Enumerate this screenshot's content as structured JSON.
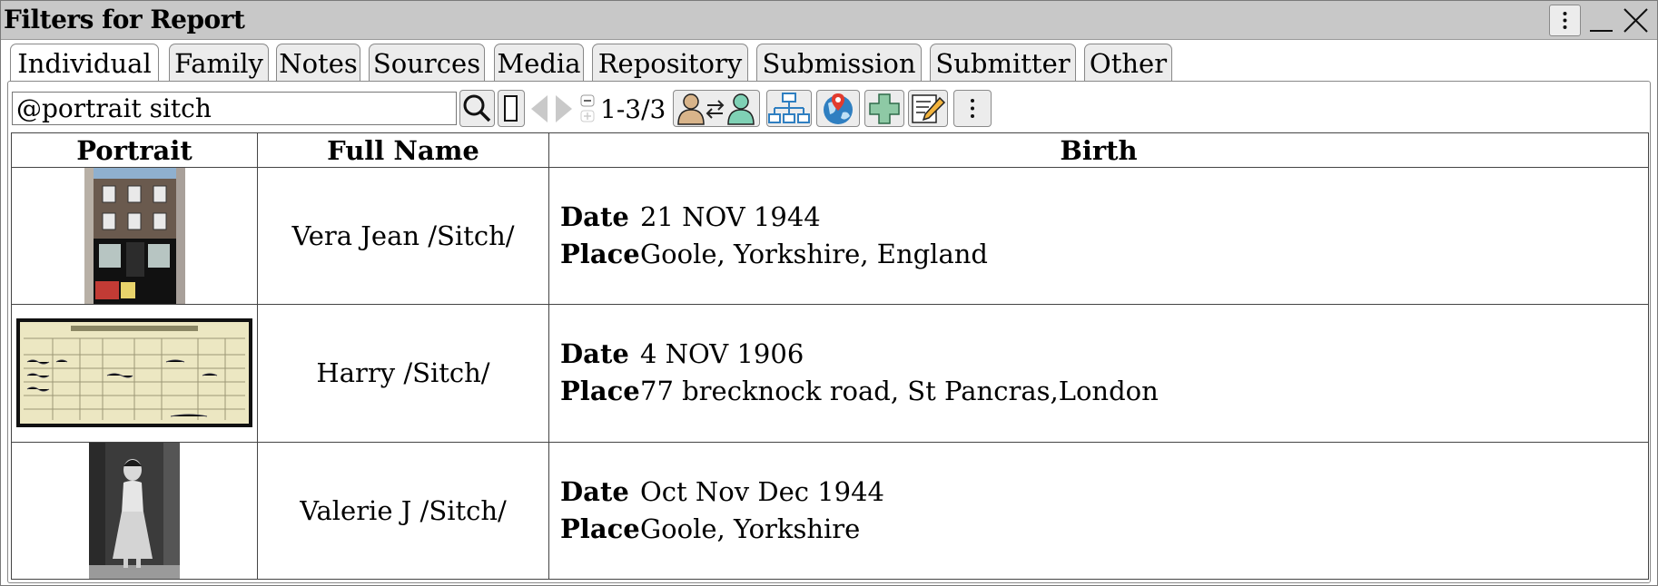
{
  "window": {
    "title": "Filters for Report",
    "menu_icon": "kebab-menu-icon",
    "minimize_icon": "minimize-icon",
    "close_icon": "close-icon"
  },
  "tabs": [
    {
      "label": "Individual",
      "active": true
    },
    {
      "label": "Family",
      "active": false
    },
    {
      "label": "Notes",
      "active": false
    },
    {
      "label": "Sources",
      "active": false
    },
    {
      "label": "Media",
      "active": false
    },
    {
      "label": "Repository",
      "active": false
    },
    {
      "label": "Submission",
      "active": false
    },
    {
      "label": "Submitter",
      "active": false
    },
    {
      "label": "Other",
      "active": false
    }
  ],
  "toolbar": {
    "search_value": "@portrait  sitch",
    "count": "1-3/3",
    "icons": [
      "search-icon",
      "clear-filter-icon",
      "prev-icon",
      "next-icon",
      "zoom-icon",
      "swap-people-icon",
      "tree-icon",
      "map-pin-icon",
      "add-icon",
      "edit-icon",
      "more-icon"
    ]
  },
  "table": {
    "columns": [
      "Portrait",
      "Full Name",
      "Birth"
    ],
    "date_label": "Date",
    "place_label": "Place",
    "rows": [
      {
        "portrait": "shop-front-photo",
        "name": "Vera Jean /Sitch/",
        "date": "21 NOV 1944",
        "place": "Goole, Yorkshire, England"
      },
      {
        "portrait": "census-document-photo",
        "name": "Harry /Sitch/",
        "date": "4 NOV 1906",
        "place": "77 brecknock road, St Pancras,London"
      },
      {
        "portrait": "woman-portrait-photo",
        "name": "Valerie J /Sitch/",
        "date": "Oct Nov Dec 1944",
        "place": "Goole, Yorkshire"
      }
    ]
  },
  "colors": {
    "titlebar": "#c8c8c8",
    "button_face": "#ececec",
    "tree_blue": "#2f7fc1",
    "add_green": "#8ec9a5"
  }
}
